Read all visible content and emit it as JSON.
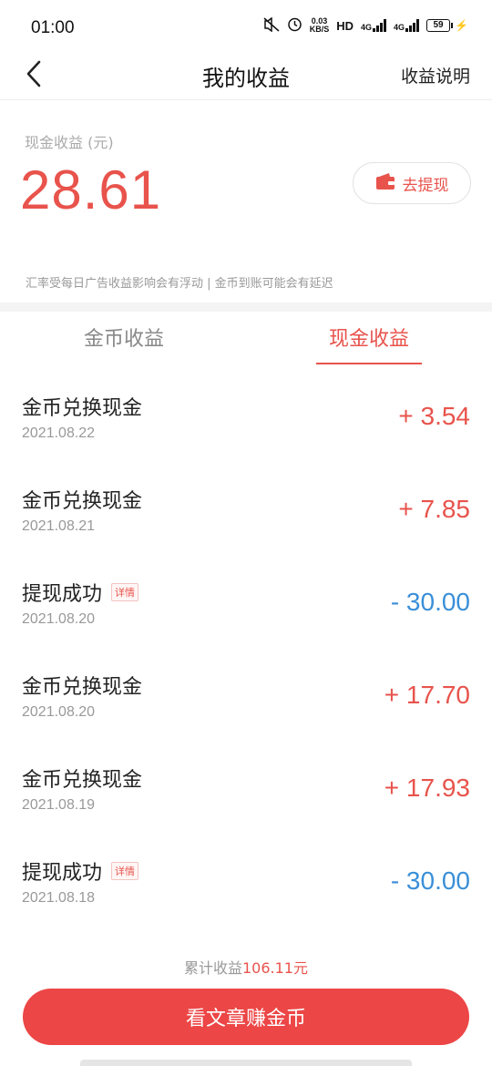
{
  "status_bar": {
    "time": "01:00",
    "net_speed_value": "0.03",
    "net_speed_unit": "KB/S",
    "hd_label": "HD",
    "signal_1_label": "4G",
    "signal_2_label": "4G",
    "battery_level": "59"
  },
  "nav": {
    "title": "我的收益",
    "help_label": "收益说明"
  },
  "balance": {
    "label": "现金收益 (元)",
    "value": "28.61",
    "withdraw_label": "去提现",
    "notice": "汇率受每日广告收益影响会有浮动 | 金币到账可能会有延迟"
  },
  "tabs": [
    {
      "label": "金币收益",
      "active": false
    },
    {
      "label": "现金收益",
      "active": true
    }
  ],
  "transactions": [
    {
      "title": "金币兑换现金",
      "date": "2021.08.22",
      "amount": "+ 3.54",
      "has_detail": false
    },
    {
      "title": "金币兑换现金",
      "date": "2021.08.21",
      "amount": "+ 7.85",
      "has_detail": false
    },
    {
      "title": "提现成功",
      "date": "2021.08.20",
      "amount": "- 30.00",
      "has_detail": true,
      "detail_label": "详情"
    },
    {
      "title": "金币兑换现金",
      "date": "2021.08.20",
      "amount": "+ 17.70",
      "has_detail": false
    },
    {
      "title": "金币兑换现金",
      "date": "2021.08.19",
      "amount": "+ 17.93",
      "has_detail": false
    },
    {
      "title": "提现成功",
      "date": "2021.08.18",
      "amount": "- 30.00",
      "has_detail": true,
      "detail_label": "详情"
    }
  ],
  "total": {
    "prefix": "累计收益",
    "value": "106.11",
    "suffix": "元"
  },
  "cta": {
    "label": "看文章赚金币"
  },
  "colors": {
    "accent_red": "#e8534c",
    "button_red": "#ec4646",
    "negative_blue": "#3a8fd8"
  }
}
